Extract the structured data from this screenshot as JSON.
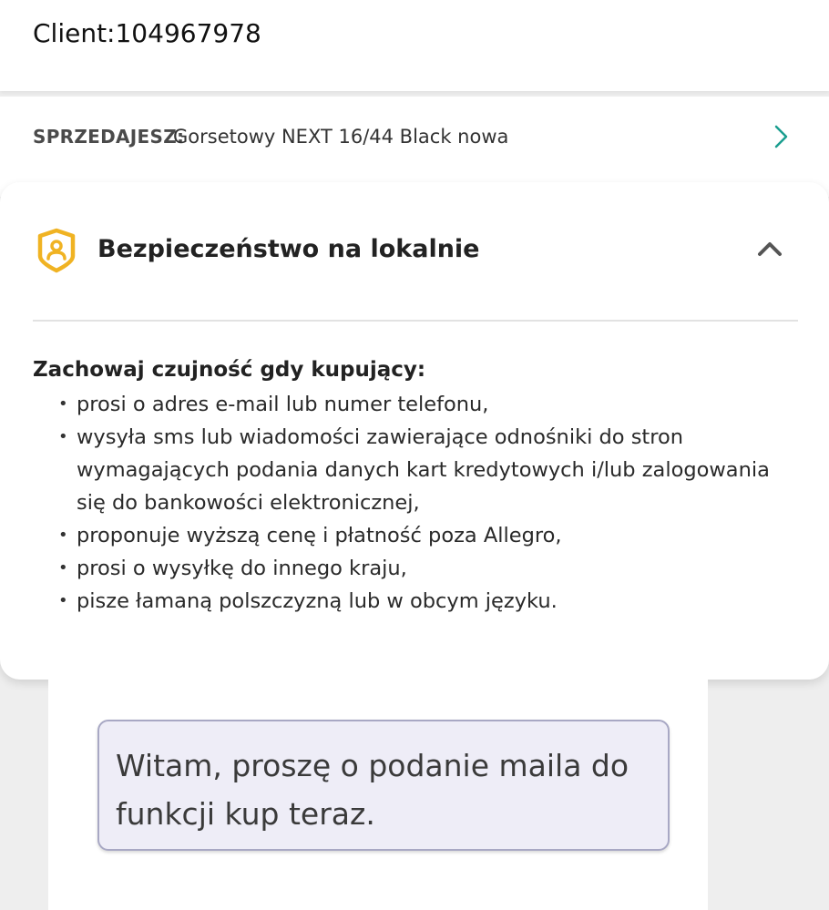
{
  "header": {
    "client_title": "Client:104967978"
  },
  "offer": {
    "label": "SPRZEDAJESZ:",
    "title": "Gorsetowy NEXT 16/44 Black nowa",
    "chevron_icon": "chevron-right-icon"
  },
  "safety_card": {
    "shield_icon": "shield-user-icon",
    "title": "Bezpieczeństwo na lokalnie",
    "collapse_icon": "chevron-up-icon",
    "warning_heading": "Zachowaj czujność gdy kupujący:",
    "warnings": [
      "prosi o adres e-mail lub numer telefonu,",
      "wysyła sms lub wiadomości zawierające odnośniki do stron wymagających podania danych kart kredytowych i/lub zalogowania się do bankowości elektronicznej,",
      "proponuje wyższą cenę i płatność poza Allegro,",
      "prosi o wysyłkę do innego kraju,",
      "pisze łamaną polszczyzną lub w obcym języku."
    ]
  },
  "chat": {
    "message": "Witam, proszę o podanie maila do funkcji kup teraz."
  },
  "colors": {
    "accent_green": "#1a9e8f",
    "shield_yellow": "#f0b323",
    "bubble_bg": "#eeedf7",
    "bubble_border": "#a8a8c4"
  }
}
